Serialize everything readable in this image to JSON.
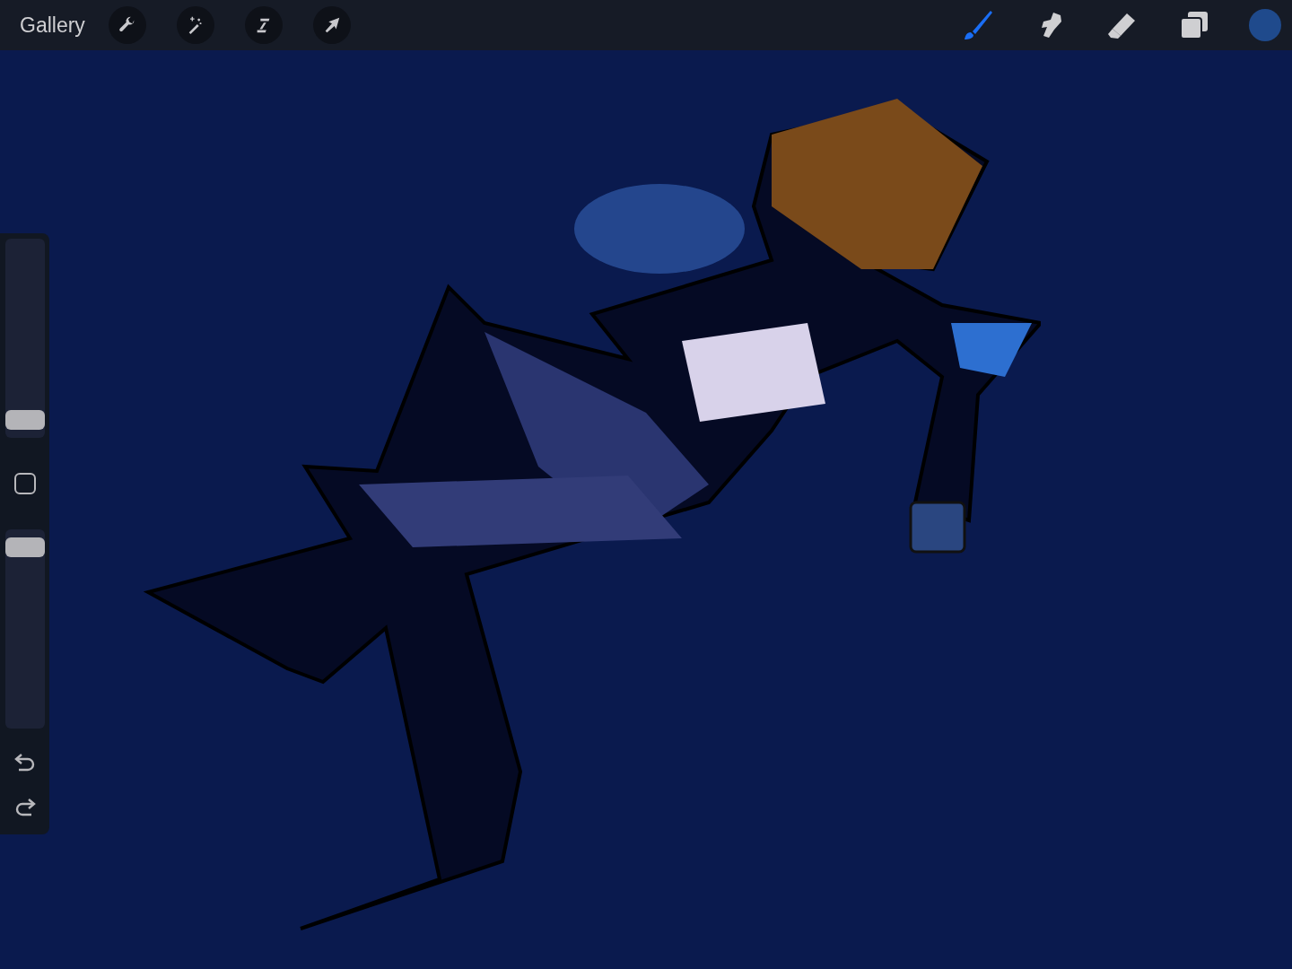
{
  "toolbar": {
    "gallery_label": "Gallery",
    "left_tools": [
      {
        "kind": "wrench"
      },
      {
        "kind": "wand"
      },
      {
        "kind": "selection"
      },
      {
        "kind": "transform"
      }
    ],
    "right_tools": [
      {
        "kind": "brush",
        "selected": true
      },
      {
        "kind": "smudge",
        "selected": false
      },
      {
        "kind": "eraser",
        "selected": false
      },
      {
        "kind": "layers",
        "selected": false
      }
    ],
    "color_swatch": {
      "color": "#1f4a8c"
    }
  },
  "sidebar": {
    "size_slider": {
      "level": 0.04
    },
    "opacity_slider": {
      "level": 0.96
    }
  }
}
